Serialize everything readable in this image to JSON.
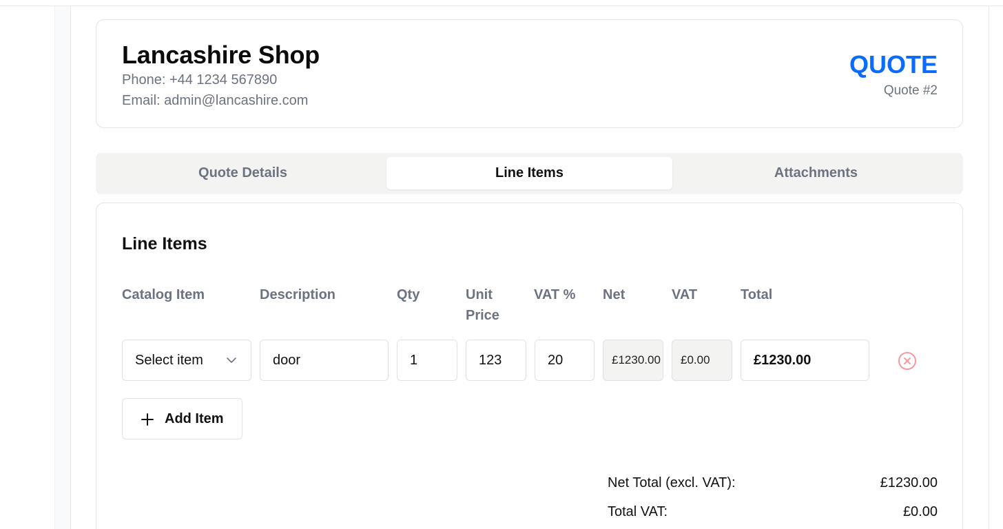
{
  "shop": {
    "name": "Lancashire Shop",
    "phone": "Phone: +44 1234 567890",
    "email": "Email: admin@lancashire.com"
  },
  "document": {
    "type": "QUOTE",
    "number": "Quote #2",
    "accent_color": "#0a6cff"
  },
  "tabs": [
    {
      "label": "Quote Details",
      "active": false
    },
    {
      "label": "Line Items",
      "active": true
    },
    {
      "label": "Attachments",
      "active": false
    }
  ],
  "line_items": {
    "title": "Line Items",
    "columns": [
      "Catalog Item",
      "Description",
      "Qty",
      "Unit Price",
      "VAT %",
      "Net",
      "VAT",
      "Total"
    ],
    "rows": [
      {
        "catalog_item": "Select item",
        "description": "door",
        "qty": "1",
        "unit_price": "123",
        "vat_percent": "20",
        "net": "£1230.00",
        "vat": "£0.00",
        "total": "£1230.00"
      }
    ],
    "add_button_label": "Add Item",
    "remove_icon": "x-circle-icon",
    "remove_icon_color": "#f19aa0"
  },
  "summary": {
    "net_total_label": "Net Total (excl. VAT):",
    "net_total_value": "£1230.00",
    "total_vat_label": "Total VAT:",
    "total_vat_value": "£0.00"
  }
}
